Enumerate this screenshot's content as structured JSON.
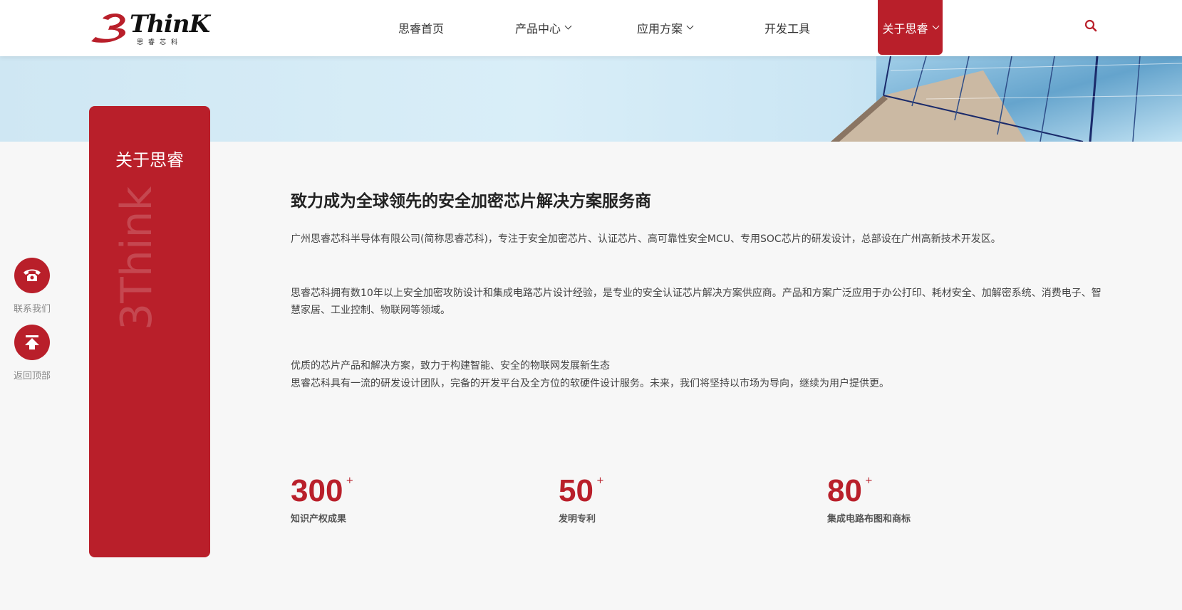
{
  "header": {
    "logo_text": "ThinK",
    "logo_sub": "思睿芯科",
    "nav": [
      {
        "label": "思睿首页",
        "dropdown": false
      },
      {
        "label": "产品中心",
        "dropdown": true
      },
      {
        "label": "应用方案",
        "dropdown": true
      },
      {
        "label": "开发工具",
        "dropdown": false
      },
      {
        "label": "关于思睿",
        "dropdown": true,
        "active": true
      }
    ],
    "search_icon": "search-icon"
  },
  "sidebar": {
    "title": "关于思睿",
    "watermark": "3Think"
  },
  "float": {
    "contact_label": "联系我们",
    "top_label": "返回顶部"
  },
  "content": {
    "title": "致力成为全球领先的安全加密芯片解决方案服务商",
    "p1": "广州思睿芯科半导体有限公司(简称思睿芯科)，专注于安全加密芯片、认证芯片、高可靠性安全MCU、专用SOC芯片的研发设计，总部设在广州高新技术开发区。",
    "p2": "思睿芯科拥有数10年以上安全加密攻防设计和集成电路芯片设计经验，是专业的安全认证芯片解决方案供应商。产品和方案广泛应用于办公打印、耗材安全、加解密系统、消费电子、智慧家居、工业控制、物联网等领域。",
    "p3a": "优质的芯片产品和解决方案，致力于构建智能、安全的物联网发展新生态",
    "p3b": "思睿芯科具有一流的研发设计团队，完备的开发平台及全方位的软硬件设计服务。未来，我们将坚持以市场为导向，继续为用户提供更。"
  },
  "stats": [
    {
      "value": "300",
      "plus": "+",
      "label": "知识产权成果"
    },
    {
      "value": "50",
      "plus": "+",
      "label": "发明专利"
    },
    {
      "value": "80",
      "plus": "+",
      "label": "集成电路布图和商标"
    }
  ],
  "colors": {
    "brand_red": "#b91f2a"
  }
}
